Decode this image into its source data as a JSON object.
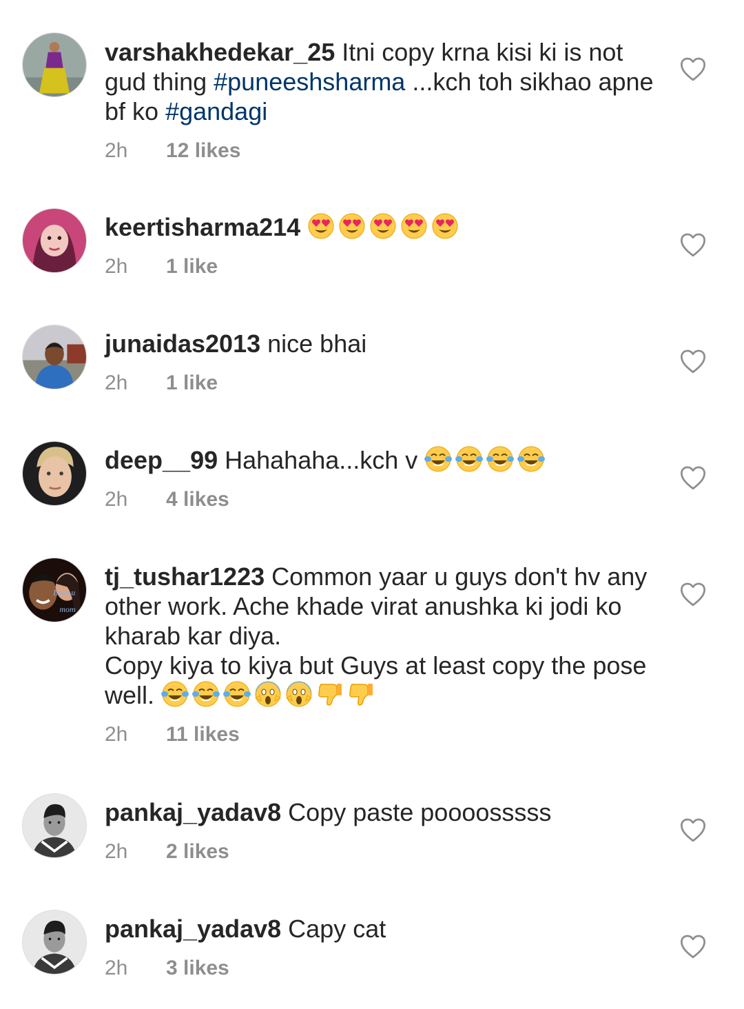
{
  "comments": [
    {
      "username": "varshakhedekar_25",
      "text_parts": [
        {
          "type": "text",
          "value": "Itni copy krna kisi ki is not gud thing "
        },
        {
          "type": "tag",
          "value": "#puneeshsharma"
        },
        {
          "type": "text",
          "value": " ...kch toh sikhao apne bf ko "
        },
        {
          "type": "tag",
          "value": "#gandagi"
        }
      ],
      "time": "2h",
      "likes": "12 likes",
      "avatar_icon": "avatar-purple-dress"
    },
    {
      "username": "keertisharma214",
      "text_parts": [
        {
          "type": "emoji",
          "value": "heart-eyes-emoji"
        },
        {
          "type": "emoji",
          "value": "heart-eyes-emoji"
        },
        {
          "type": "emoji",
          "value": "heart-eyes-emoji"
        },
        {
          "type": "emoji",
          "value": "heart-eyes-emoji"
        },
        {
          "type": "emoji",
          "value": "heart-eyes-emoji"
        }
      ],
      "time": "2h",
      "likes": "1 like",
      "avatar_icon": "avatar-pink-hair"
    },
    {
      "username": "junaidas2013",
      "text_parts": [
        {
          "type": "text",
          "value": "nice bhai"
        }
      ],
      "time": "2h",
      "likes": "1 like",
      "avatar_icon": "avatar-boy-outdoor"
    },
    {
      "username": "deep__99",
      "text_parts": [
        {
          "type": "text",
          "value": "Hahahaha...kch v "
        },
        {
          "type": "emoji",
          "value": "tears-of-joy-emoji"
        },
        {
          "type": "emoji",
          "value": "tears-of-joy-emoji"
        },
        {
          "type": "emoji",
          "value": "tears-of-joy-emoji"
        },
        {
          "type": "emoji",
          "value": "tears-of-joy-emoji"
        }
      ],
      "time": "2h",
      "likes": "4 likes",
      "avatar_icon": "avatar-blond-man"
    },
    {
      "username": "tj_tushar1223",
      "text_parts": [
        {
          "type": "text",
          "value": "Common yaar u guys don't hv any other work. Ache khade virat anushka ki jodi ko kharab kar diya.\nCopy kiya to kiya but Guys at least copy the pose well. "
        },
        {
          "type": "emoji",
          "value": "tears-of-joy-emoji"
        },
        {
          "type": "emoji",
          "value": "tears-of-joy-emoji"
        },
        {
          "type": "emoji",
          "value": "tears-of-joy-emoji"
        },
        {
          "type": "emoji",
          "value": "screaming-fear-emoji"
        },
        {
          "type": "emoji",
          "value": "screaming-fear-emoji"
        },
        {
          "type": "emoji",
          "value": "thumbs-down-emoji"
        },
        {
          "type": "emoji",
          "value": "thumbs-down-emoji"
        }
      ],
      "time": "2h",
      "likes": "11 likes",
      "avatar_icon": "avatar-couple",
      "avatar_text": [
        "Love u",
        "mom"
      ]
    },
    {
      "username": "pankaj_yadav8",
      "text_parts": [
        {
          "type": "text",
          "value": "Copy paste poooosssss"
        }
      ],
      "time": "2h",
      "likes": "2 likes",
      "avatar_icon": "avatar-bw-man"
    },
    {
      "username": "pankaj_yadav8",
      "text_parts": [
        {
          "type": "text",
          "value": "Capy cat"
        }
      ],
      "time": "2h",
      "likes": "3 likes",
      "avatar_icon": "avatar-bw-man"
    }
  ],
  "like_icon": "heart-outline-icon",
  "colors": {
    "text": "#262626",
    "hashtag": "#003569",
    "meta": "#8e8e8e",
    "icon": "#8e8e8e"
  }
}
